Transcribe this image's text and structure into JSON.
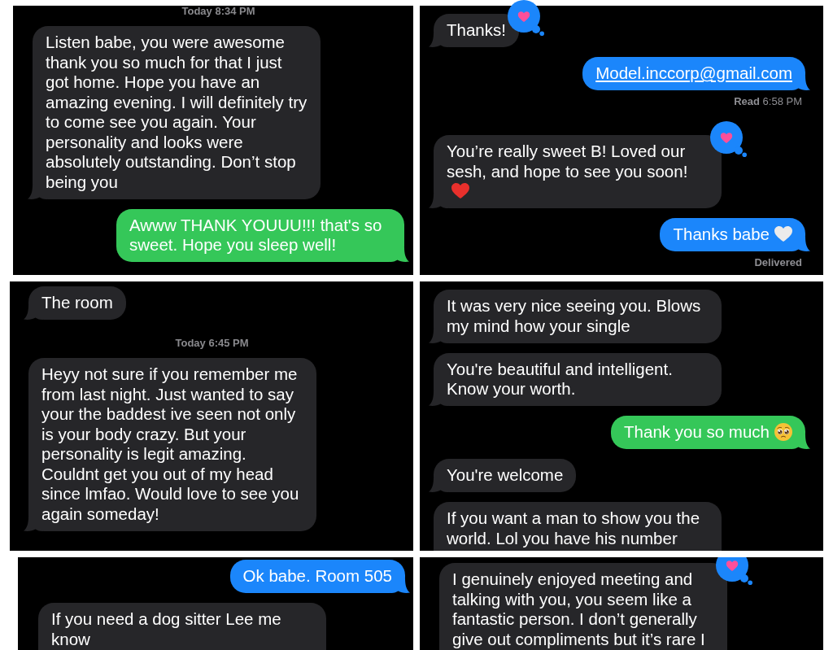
{
  "panels": [
    {
      "kind": "sms",
      "items": [
        {
          "kind": "timestamp",
          "text": "Today 8:34 PM"
        },
        {
          "kind": "received",
          "text": "Listen babe, you were awesome thank you so much for that I just got home. Hope you have an amazing evening. I will definitely try to come see you again. Your personality and looks were absolutely outstanding. Don’t stop being you",
          "loved": false
        },
        {
          "kind": "sent",
          "text": "Awww THANK YOUUU!!! that's so sweet. Hope you sleep well!",
          "loved": false
        }
      ]
    },
    {
      "kind": "imessage",
      "items": [
        {
          "kind": "received",
          "text": "Thanks!",
          "loved": true
        },
        {
          "kind": "link",
          "text": "Model.inccorp@gmail.com",
          "loved": false
        },
        {
          "kind": "status",
          "label": "Read",
          "time": "6:58 PM"
        },
        {
          "kind": "received",
          "text": "You’re really sweet B! Loved our sesh, and hope to see you soon!",
          "loved": true,
          "emoji": {
            "kind": "heart",
            "color": "#e8302c"
          }
        },
        {
          "kind": "sent",
          "text": "Thanks babe",
          "loved": false,
          "emoji": {
            "kind": "heart",
            "color": "#ebebeb"
          }
        },
        {
          "kind": "status",
          "label": "Delivered"
        }
      ]
    },
    {
      "items": [
        {
          "kind": "received",
          "text": "The room",
          "loved": false
        },
        {
          "kind": "timestamp",
          "text": "Today 6:45 PM"
        },
        {
          "kind": "received",
          "text": "Heyy not sure if you remember me from last night. Just wanted to say your the baddest ive seen not only is your body crazy. But your personality is legit amazing. Couldnt get you out of my head since lmfao. Would love to see you again someday!",
          "loved": false
        }
      ]
    },
    {
      "kind": "sms",
      "items": [
        {
          "kind": "received",
          "text": "It was very nice seeing you. Blows my mind how your single",
          "loved": false
        },
        {
          "kind": "received",
          "text": "You're beautiful and intelligent. Know your worth.",
          "loved": false
        },
        {
          "kind": "sent",
          "text": "Thank you so much",
          "loved": false,
          "emoji": {
            "kind": "face"
          }
        },
        {
          "kind": "received",
          "text": "You're welcome",
          "loved": false
        },
        {
          "kind": "received",
          "text": "If you want a man to show you the world. Lol you have his number",
          "loved": false
        }
      ]
    },
    {
      "kind": "imessage",
      "items": [
        {
          "kind": "sent",
          "text": "Ok babe. Room 505",
          "loved": false
        },
        {
          "kind": "received",
          "text": "If you need a dog sitter Lee me know",
          "loved": false
        }
      ]
    },
    {
      "items": [
        {
          "kind": "received",
          "text": "I genuinely enjoyed meeting and talking with you, you seem like a fantastic person. I don’t generally give out compliments but it’s rare I",
          "loved": true
        }
      ]
    }
  ]
}
